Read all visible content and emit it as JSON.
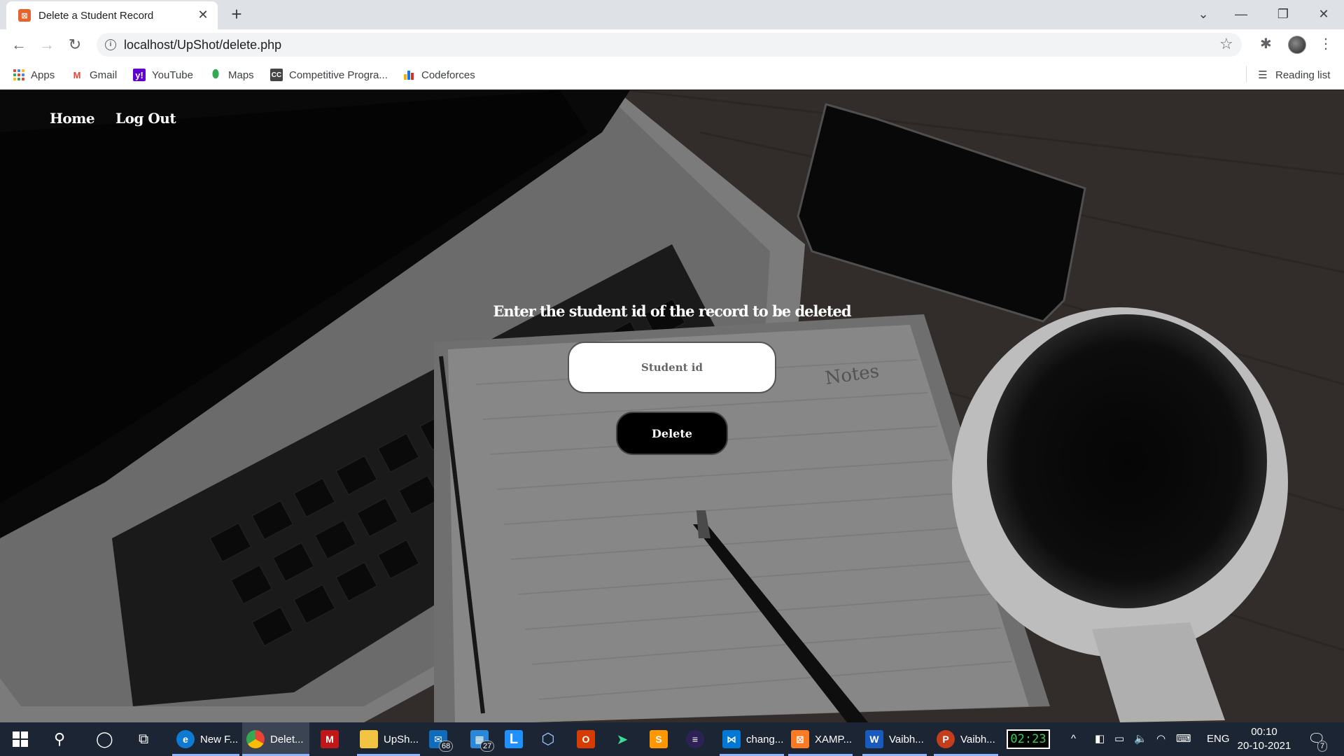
{
  "browser": {
    "tab_title": "Delete a Student Record",
    "tab_favicon": "XAMPP",
    "url": "localhost/UpShot/delete.php",
    "bookmarks": [
      "Apps",
      "Gmail",
      "YouTube",
      "Maps",
      "Competitive Progra...",
      "Codeforces"
    ],
    "reading_list": "Reading list"
  },
  "page": {
    "nav": {
      "home": "Home",
      "logout": "Log Out"
    },
    "heading": "Enter the student id of the record to be deleted",
    "input_placeholder": "Student id",
    "input_value": "",
    "delete_label": "Delete",
    "background_image": "laptop, notebook, pen, phone and coffee cup on a desk"
  },
  "taskbar": {
    "apps": [
      {
        "label": "New F...",
        "icon": "edge-icon"
      },
      {
        "label": "Delet...",
        "icon": "chrome-icon",
        "active": true
      },
      {
        "label": "",
        "icon": "mcafee-icon"
      },
      {
        "label": "UpSh...",
        "icon": "folder-icon"
      },
      {
        "label": "",
        "icon": "mail-icon",
        "badge": "68"
      },
      {
        "label": "",
        "icon": "calendar-icon",
        "badge": "27"
      },
      {
        "label": "",
        "icon": "l-app-icon"
      },
      {
        "label": "",
        "icon": "3d-box-icon"
      },
      {
        "label": "",
        "icon": "office-icon"
      },
      {
        "label": "",
        "icon": "arrow-app-icon"
      },
      {
        "label": "",
        "icon": "sublime-icon"
      },
      {
        "label": "",
        "icon": "eclipse-icon"
      },
      {
        "label": "chang...",
        "icon": "vscode-icon"
      },
      {
        "label": "XAMP...",
        "icon": "xampp-icon"
      },
      {
        "label": "Vaibh...",
        "icon": "word-icon"
      },
      {
        "label": "Vaibh...",
        "icon": "powerpoint-icon"
      }
    ],
    "battery": "02:23",
    "language": "ENG",
    "time": "00:10",
    "date": "20-10-2021",
    "notifications": "7"
  },
  "colors": {
    "tabbar": "#dee1e6",
    "taskbar": "#1c2534",
    "button_bg": "#000000",
    "heading_text": "#ffffff"
  }
}
